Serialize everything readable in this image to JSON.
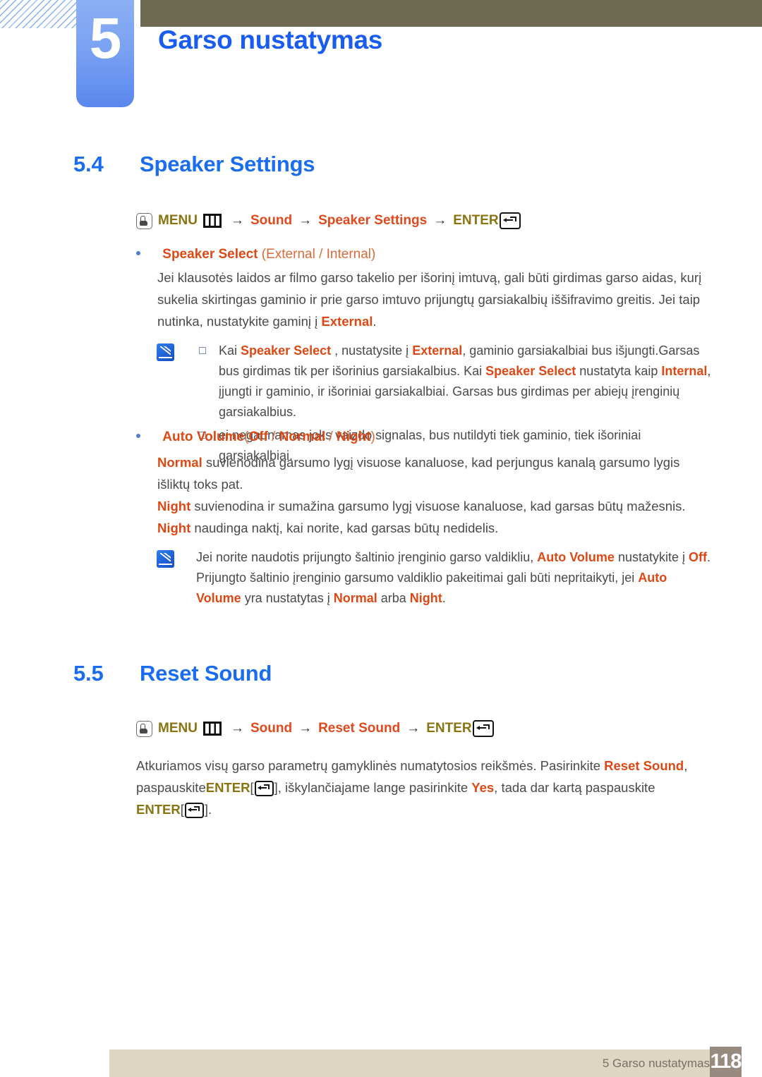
{
  "header": {
    "chapter_number": "5",
    "chapter_title": "Garso nustatymas"
  },
  "sections": [
    {
      "number": "5.4",
      "title": "Speaker Settings"
    },
    {
      "number": "5.5",
      "title": "Reset Sound"
    }
  ],
  "navpath_1": {
    "menu_label": "MENU",
    "item_sound": "Sound",
    "item_target": "Speaker Settings",
    "enter_label": "ENTER",
    "arrow": "→"
  },
  "navpath_2": {
    "menu_label": "MENU",
    "item_sound": "Sound",
    "item_target": "Reset Sound",
    "enter_label": "ENTER",
    "arrow": "→"
  },
  "bullet_speaker_select": {
    "keyword": "Speaker Select",
    "options": "(External / Internal)"
  },
  "bullet_auto_volume": {
    "keyword": "Auto Volume",
    "paren_open": "(",
    "opt_off": "Off",
    "sep1": " / ",
    "opt_normal": "Normal",
    "sep2": " / ",
    "opt_night": "Night",
    "paren_close": ")"
  },
  "paragraph_speaker": {
    "part1": "Jei klausotės laidos ar filmo garso takelio per išorinį imtuvą, gali būti girdimas garso aidas, kurį sukelia skirtingas gaminio ir prie garso imtuvo prijungtų garsiakalbių iššifravimo greitis. Jei taip nutinka, nustatykite gaminį į ",
    "hl1": "External",
    "part2": "."
  },
  "note_speaker": {
    "line1": {
      "t1": "Kai ",
      "hl1": "Speaker Select",
      "t2": " , nustatysite į ",
      "hl2": "External",
      "t3": ", gaminio garsiakalbiai bus išjungti.Garsas bus girdimas tik per išorinius garsiakalbius. Kai ",
      "hl3": "Speaker Select",
      "t4": " nustatyta kaip ",
      "hl4": "Internal",
      "t5": ", įjungti ir gaminio, ir išoriniai garsiakalbiai. Garsas bus girdimas per abiejų įrenginių garsiakalbius."
    },
    "line2": {
      "t1": "ei negaunamas joks vaizdo signalas, bus nutildyti tiek gaminio, tiek išoriniai garsiakalbiai."
    }
  },
  "paragraph_normal": {
    "hl1": "Normal",
    "part1": " suvienodina garsumo lygį visuose kanaluose, kad perjungus kanalą garsumo lygis išliktų toks pat."
  },
  "paragraph_night": {
    "hl1": "Night",
    "part1": " suvienodina ir sumažina garsumo lygį visuose kanaluose, kad garsas būtų mažesnis. ",
    "hl2": "Night",
    "part2": " naudinga naktį, kai norite, kad garsas būtų nedidelis."
  },
  "note_auto_volume": {
    "t1": "Jei norite naudotis prijungto šaltinio įrenginio garso valdikliu, ",
    "hl1": "Auto Volume",
    "t2": " nustatykite į ",
    "hl2": "Off",
    "t3": ". Prijungto šaltinio įrenginio garsumo valdiklio pakeitimai gali būti nepritaikyti, jei ",
    "hl3": "Auto Volume",
    "t4": " yra nustatytas į ",
    "hl4": "Normal",
    "t5": " arba ",
    "hl5": "Night",
    "t6": "."
  },
  "paragraph_reset": {
    "t1": "Atkuriamos visų garso parametrų gamyklinės numatytosios reikšmės. Pasirinkite ",
    "hl1": "Reset Sound",
    "t2": ", paspauskite",
    "enter1": "ENTER",
    "t3": ", iškylančiajame lange pasirinkite ",
    "hl2": "Yes",
    "t4": ", tada dar kartą paspauskite ",
    "enter2": "ENTER",
    "t5": ".",
    "bracket_open": "[",
    "bracket_close": "]"
  },
  "footer": {
    "chapter_text": "5 Garso nustatymas",
    "page_number": "118"
  },
  "colors": {
    "chapter_blue": "#1a5cf0",
    "heading_blue": "#1a6cf0",
    "keyword_red": "#dd4814",
    "menu_olive": "#8a7410",
    "olive_bar": "#6e6a52",
    "footer_bar": "#ddd6c3",
    "footer_page_box": "#978a7e"
  }
}
